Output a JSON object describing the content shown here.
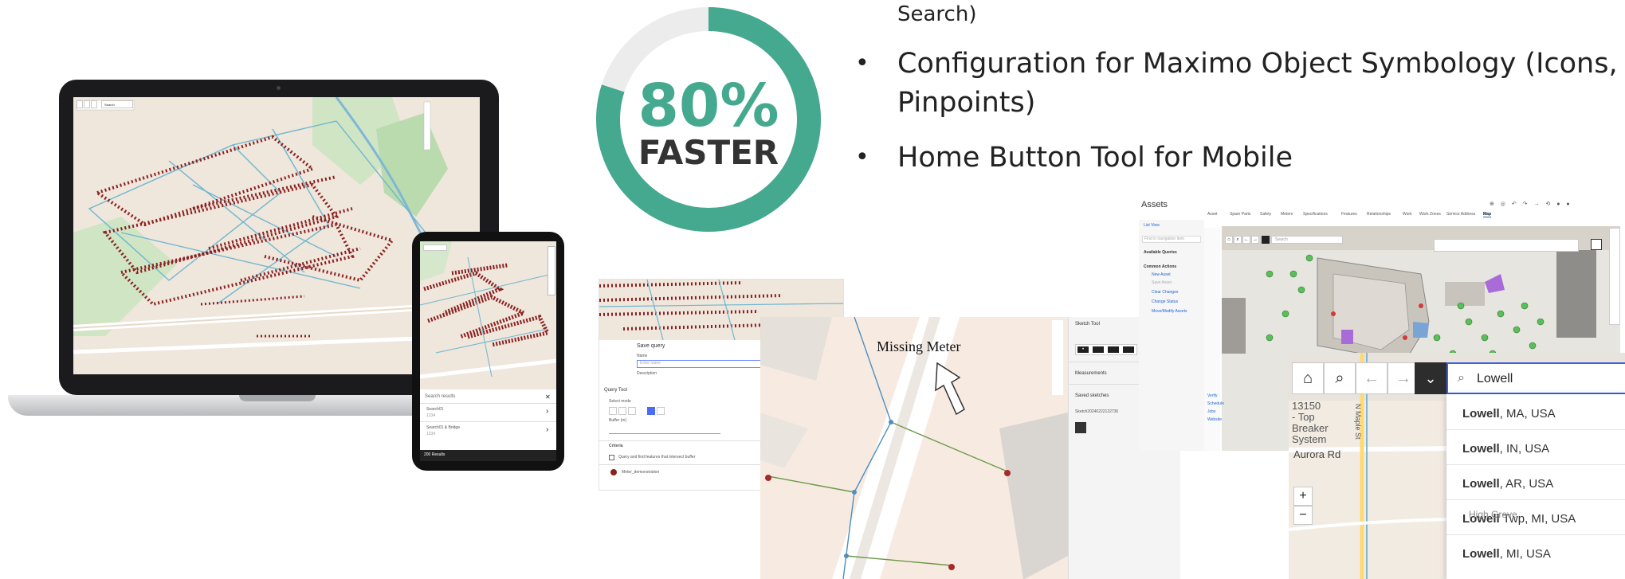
{
  "bullets": {
    "partial_top": "Search)",
    "items": [
      "Configuration for Maximo Object Symbology (Icons,",
      "Pinpoints)",
      "Home Button Tool for Mobile"
    ],
    "dot": "•"
  },
  "badge": {
    "percent": "80%",
    "label": "FASTER",
    "progress": 0.8,
    "color": "#44a98e",
    "track_color": "#ececec"
  },
  "laptop": {
    "search_placeholder": "Search"
  },
  "tablet": {
    "search_placeholder": "Search results",
    "list": [
      {
        "title": "Search01",
        "sub": "1234"
      },
      {
        "title": "Search01 & Bridge",
        "sub": "1234"
      }
    ],
    "footer": "200 Results"
  },
  "query_panel": {
    "save_query": "Save query",
    "name_label": "Name",
    "name_placeholder": "Enter name",
    "description_label": "Description",
    "query_tool_title": "Query Tool",
    "select_mode": "Select mode",
    "buffer_label": "Buffer (m)",
    "criteria_label": "Criteria",
    "criteria_text": "Query and find features that intersect buffer",
    "result_item": "Meter_demonstration"
  },
  "sketch_map": {
    "label": "Missing Meter"
  },
  "sketch_panel": {
    "title": "Sketch Tool",
    "measurements": "Measurements",
    "saved_sketches": "Saved sketches",
    "sketch_name": "Sketch20240222122736"
  },
  "assets": {
    "title": "Assets",
    "list_view": "List View",
    "find_placeholder": "Find in navigation item",
    "available_queries": "Available Queries",
    "common_actions": "Common Actions",
    "actions": [
      "New Asset",
      "Save Asset",
      "Clear Changes",
      "Change Status",
      "Move/Modify Assets"
    ],
    "tabs": [
      "Asset",
      "Spare Parts",
      "Safety",
      "Meters",
      "Specifications",
      "Features",
      "Relationships",
      "Work",
      "Work Zones",
      "Service Address",
      "Map"
    ],
    "active_tab": "Map",
    "map_search_placeholder": "Search",
    "side_links": [
      "Verify",
      "Schedule",
      "Jobs",
      "Website"
    ]
  },
  "search_overlay": {
    "query": "Lowell",
    "results": [
      {
        "bold": "Lowell",
        "rest": ", MA, USA"
      },
      {
        "bold": "Lowell",
        "rest": ", IN, USA"
      },
      {
        "bold": "Lowell",
        "rest": ", AR, USA"
      },
      {
        "bold": "Lowell",
        "rest": " Twp, MI, USA"
      },
      {
        "bold": "Lowell",
        "rest": ", MI, USA"
      }
    ],
    "map_labels": [
      "13150",
      "- Top",
      "Breaker",
      "System",
      "Aurora Rd",
      "High Grove",
      "N Maple St"
    ],
    "zoom_in": "+",
    "zoom_out": "−"
  }
}
